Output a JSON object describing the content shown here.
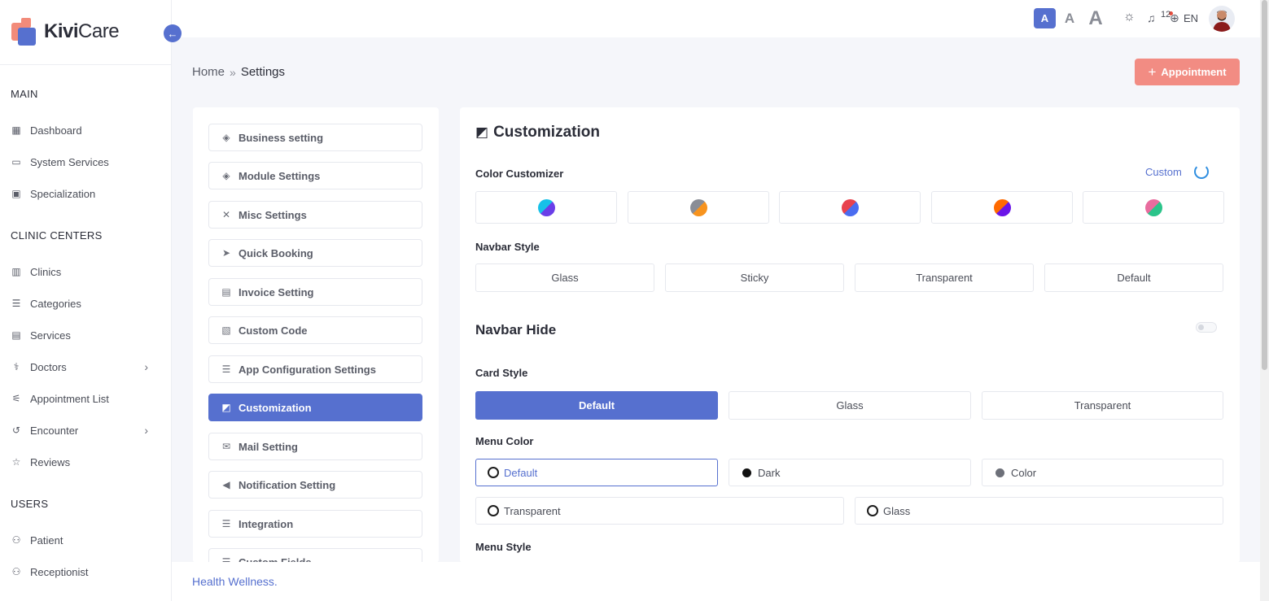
{
  "brand": {
    "name_bold": "Kivi",
    "name_rest": "Care"
  },
  "sidebar": {
    "sections": [
      "MAIN",
      "CLINIC CENTERS",
      "USERS"
    ],
    "items": [
      {
        "label": "Dashboard",
        "icon": "grid-icon"
      },
      {
        "label": "System Services",
        "icon": "monitor-icon"
      },
      {
        "label": "Specialization",
        "icon": "calendar-icon"
      },
      {
        "label": "Clinics",
        "icon": "building-icon"
      },
      {
        "label": "Categories",
        "icon": "list-icon"
      },
      {
        "label": "Services",
        "icon": "briefcase-icon"
      },
      {
        "label": "Doctors",
        "icon": "stethoscope-icon"
      },
      {
        "label": "Appointment List",
        "icon": "sliders-icon"
      },
      {
        "label": "Encounter",
        "icon": "history-icon"
      },
      {
        "label": "Reviews",
        "icon": "star-icon"
      },
      {
        "label": "Patient",
        "icon": "user-icon"
      },
      {
        "label": "Receptionist",
        "icon": "user-icon"
      }
    ]
  },
  "topbar": {
    "font_sizes": [
      "A",
      "A",
      "A"
    ],
    "notification_count": "12",
    "language": "EN"
  },
  "breadcrumb": {
    "home": "Home",
    "current": "Settings"
  },
  "actions": {
    "appointment_label": "Appointment"
  },
  "settings_menu": [
    "Business setting",
    "Module Settings",
    "Misc Settings",
    "Quick Booking",
    "Invoice Setting",
    "Custom Code",
    "App Configuration Settings",
    "Customization",
    "Mail Setting",
    "Notification Setting",
    "Integration",
    "Custom Fields"
  ],
  "customization": {
    "title": "Customization",
    "color_customizer_label": "Color Customizer",
    "custom_link": "Custom",
    "color_swatches": [
      [
        "#17c1e8",
        "#6a3ee8"
      ],
      [
        "#8a8d96",
        "#f7931e"
      ],
      [
        "#e8424e",
        "#4a6cf0"
      ],
      [
        "#ff6a00",
        "#6a14e8"
      ],
      [
        "#e86c9e",
        "#2bc48a"
      ]
    ],
    "navbar_style_label": "Navbar Style",
    "navbar_styles": [
      "Glass",
      "Sticky",
      "Transparent",
      "Default"
    ],
    "navbar_hide_label": "Navbar Hide",
    "card_style_label": "Card Style",
    "card_styles": [
      "Default",
      "Glass",
      "Transparent"
    ],
    "menu_color_label": "Menu Color",
    "menu_colors": [
      "Default",
      "Dark",
      "Color",
      "Transparent",
      "Glass"
    ],
    "menu_style_label": "Menu Style"
  },
  "footer": {
    "text": "Health Wellness."
  }
}
